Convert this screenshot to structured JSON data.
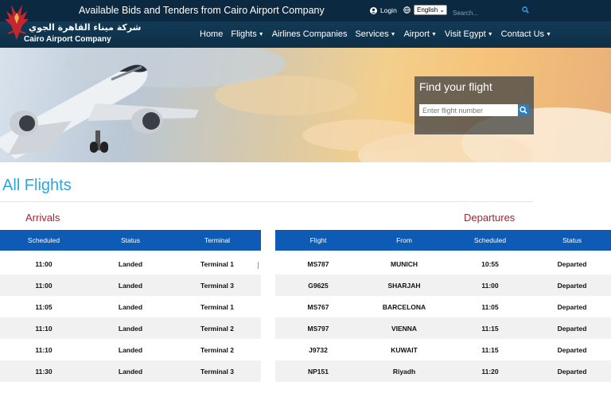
{
  "header": {
    "announcement": "Available Bids and Tenders from Cairo Airport Company",
    "login": "Login",
    "language": "English",
    "search_placeholder": "Search...",
    "logo_arabic": "شركة ميناء القاهرة الجوي",
    "logo_english": "Cairo Airport Company"
  },
  "nav": {
    "items": [
      {
        "label": "Home"
      },
      {
        "label": "Flights"
      },
      {
        "label": "Airlines Companies"
      },
      {
        "label": "Services"
      },
      {
        "label": "Airport"
      },
      {
        "label": "Visit Egypt"
      },
      {
        "label": "Contact Us"
      }
    ]
  },
  "finder": {
    "title": "Find your flight",
    "placeholder": "Enter flight number"
  },
  "main": {
    "title": "All Flights",
    "arrivals_title": "Arrivals",
    "departures_title": "Departures"
  },
  "arrivals": {
    "columns": [
      "Scheduled",
      "Status",
      "Terminal"
    ],
    "rows": [
      [
        "11:00",
        "Landed",
        "Terminal 1"
      ],
      [
        "11:00",
        "Landed",
        "Terminal 3"
      ],
      [
        "11:05",
        "Landed",
        "Terminal 1"
      ],
      [
        "11:10",
        "Landed",
        "Terminal 2"
      ],
      [
        "11:10",
        "Landed",
        "Terminal 2"
      ],
      [
        "11:30",
        "Landed",
        "Terminal 3"
      ]
    ]
  },
  "departures": {
    "columns": [
      "Flight",
      "From",
      "Scheduled",
      "Status"
    ],
    "rows": [
      [
        "MS787",
        "MUNICH",
        "10:55",
        "Departed"
      ],
      [
        "G9625",
        "SHARJAH",
        "11:00",
        "Departed"
      ],
      [
        "MS767",
        "BARCELONA",
        "11:05",
        "Departed"
      ],
      [
        "MS797",
        "VIENNA",
        "11:15",
        "Departed"
      ],
      [
        "J9732",
        "KUWAIT",
        "11:15",
        "Departed"
      ],
      [
        "NP151",
        "Riyadh",
        "11:20",
        "Departed"
      ]
    ]
  }
}
